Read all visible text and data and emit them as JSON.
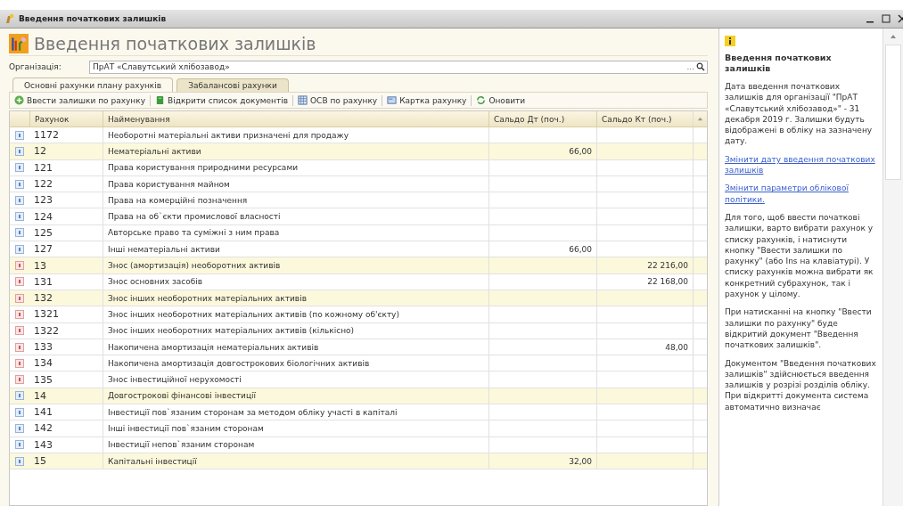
{
  "window": {
    "title": "Введення початкових залишків"
  },
  "header": {
    "title": "Введення початкових залишків"
  },
  "organization": {
    "label": "Організація:",
    "value": "ПрАТ «Славутський хлібозавод»",
    "select_button": "..."
  },
  "tabs": [
    {
      "label": "Основні рахунки плану рахунків",
      "selected": true
    },
    {
      "label": "Забалансові рахунки",
      "selected": false
    }
  ],
  "toolbar": [
    {
      "kind": "add",
      "label": "Ввести залишки по рахунку"
    },
    {
      "kind": "docs",
      "label": "Відкрити список документів"
    },
    {
      "kind": "report",
      "label": "ОСВ по рахунку"
    },
    {
      "kind": "card",
      "label": "Картка рахунку"
    },
    {
      "kind": "refresh",
      "label": "Оновити"
    }
  ],
  "table": {
    "columns": [
      "Рахунок",
      "Найменування",
      "Сальдо Дт (поч.)",
      "Сальдо Кт (поч.)"
    ],
    "rows": [
      {
        "kind": "active",
        "group": false,
        "account": "1172",
        "name": "Необоротні матеріальні активи призначені для продажу",
        "debit": "",
        "credit": ""
      },
      {
        "kind": "active",
        "group": true,
        "account": "12",
        "name": "Нематеріальні активи",
        "debit": "66,00",
        "credit": ""
      },
      {
        "kind": "active",
        "group": false,
        "account": "121",
        "name": "Права користування природними ресурсами",
        "debit": "",
        "credit": ""
      },
      {
        "kind": "active",
        "group": false,
        "account": "122",
        "name": "Права користування майном",
        "debit": "",
        "credit": ""
      },
      {
        "kind": "active",
        "group": false,
        "account": "123",
        "name": "Права на комерційні позначення",
        "debit": "",
        "credit": ""
      },
      {
        "kind": "active",
        "group": false,
        "account": "124",
        "name": "Права на об`єкти промислової власності",
        "debit": "",
        "credit": ""
      },
      {
        "kind": "active",
        "group": false,
        "account": "125",
        "name": "Авторське право та суміжні з ним права",
        "debit": "",
        "credit": ""
      },
      {
        "kind": "active",
        "group": false,
        "account": "127",
        "name": "Інші нематеріальні активи",
        "debit": "66,00",
        "credit": ""
      },
      {
        "kind": "passive",
        "group": true,
        "account": "13",
        "name": "Знос (амортизація) необоротних активів",
        "debit": "",
        "credit": "22 216,00"
      },
      {
        "kind": "passive",
        "group": false,
        "account": "131",
        "name": "Знос основних засобів",
        "debit": "",
        "credit": "22 168,00"
      },
      {
        "kind": "passive",
        "group": true,
        "account": "132",
        "name": "Знос інших необоротних матеріальних активів",
        "debit": "",
        "credit": ""
      },
      {
        "kind": "passive",
        "group": false,
        "account": "1321",
        "name": "Знос інших необоротних матеріальних активів (по кожному об'єкту)",
        "debit": "",
        "credit": ""
      },
      {
        "kind": "passive",
        "group": false,
        "account": "1322",
        "name": "Знос інших необоротних матеріальних активів (кількісно)",
        "debit": "",
        "credit": ""
      },
      {
        "kind": "passive",
        "group": false,
        "account": "133",
        "name": "Накопичена амортизація нематеріальних активів",
        "debit": "",
        "credit": "48,00"
      },
      {
        "kind": "passive",
        "group": false,
        "account": "134",
        "name": "Накопичена амортизація довгострокових біологічних активів",
        "debit": "",
        "credit": ""
      },
      {
        "kind": "passive",
        "group": false,
        "account": "135",
        "name": "Знос інвестиційної нерухомості",
        "debit": "",
        "credit": ""
      },
      {
        "kind": "active",
        "group": true,
        "account": "14",
        "name": "Довгострокові фінансові інвестиції",
        "debit": "",
        "credit": ""
      },
      {
        "kind": "active",
        "group": false,
        "account": "141",
        "name": "Інвестиції пов`язаним сторонам за методом обліку участі в капіталі",
        "debit": "",
        "credit": ""
      },
      {
        "kind": "active",
        "group": false,
        "account": "142",
        "name": "Інші інвестиції пов`язаним сторонам",
        "debit": "",
        "credit": ""
      },
      {
        "kind": "active",
        "group": false,
        "account": "143",
        "name": "Інвестиції непов`язаним сторонам",
        "debit": "",
        "credit": ""
      },
      {
        "kind": "active",
        "group": true,
        "account": "15",
        "name": "Капітальні інвестиції",
        "debit": "32,00",
        "credit": ""
      }
    ]
  },
  "help": {
    "title": "Введення початкових залишків",
    "paragraphs": [
      {
        "kind": "text",
        "text": "Дата введення початкових залишків для організації \"ПрАТ «Славутський хлібозавод»\" - 31 декабря 2019 г. Залишки будуть відображені в обліку на зазначену дату."
      },
      {
        "kind": "link",
        "text": "Змінити дату введення початкових залишків"
      },
      {
        "kind": "link",
        "text": "Змінити параметри облікової політики."
      },
      {
        "kind": "text",
        "text": "Для того, щоб ввести початкові залишки, варто вибрати рахунок у списку рахунків, і натиснути кнопку \"Ввести залишки по рахунку\" (або Ins на клавіатурі). У списку рахунків можна вибрати як конкретний субрахунок, так і рахунок у цілому."
      },
      {
        "kind": "text",
        "text": "При натисканні на кнопку \"Ввести залишки по рахунку\" буде відкритий документ \"Введення початкових залишків\"."
      },
      {
        "kind": "text",
        "text": "Документом \"Введення початкових залишків\" здійснюється введення залишків у розрізі розділів обліку. При відкритті документа система автоматично визначає"
      }
    ]
  }
}
